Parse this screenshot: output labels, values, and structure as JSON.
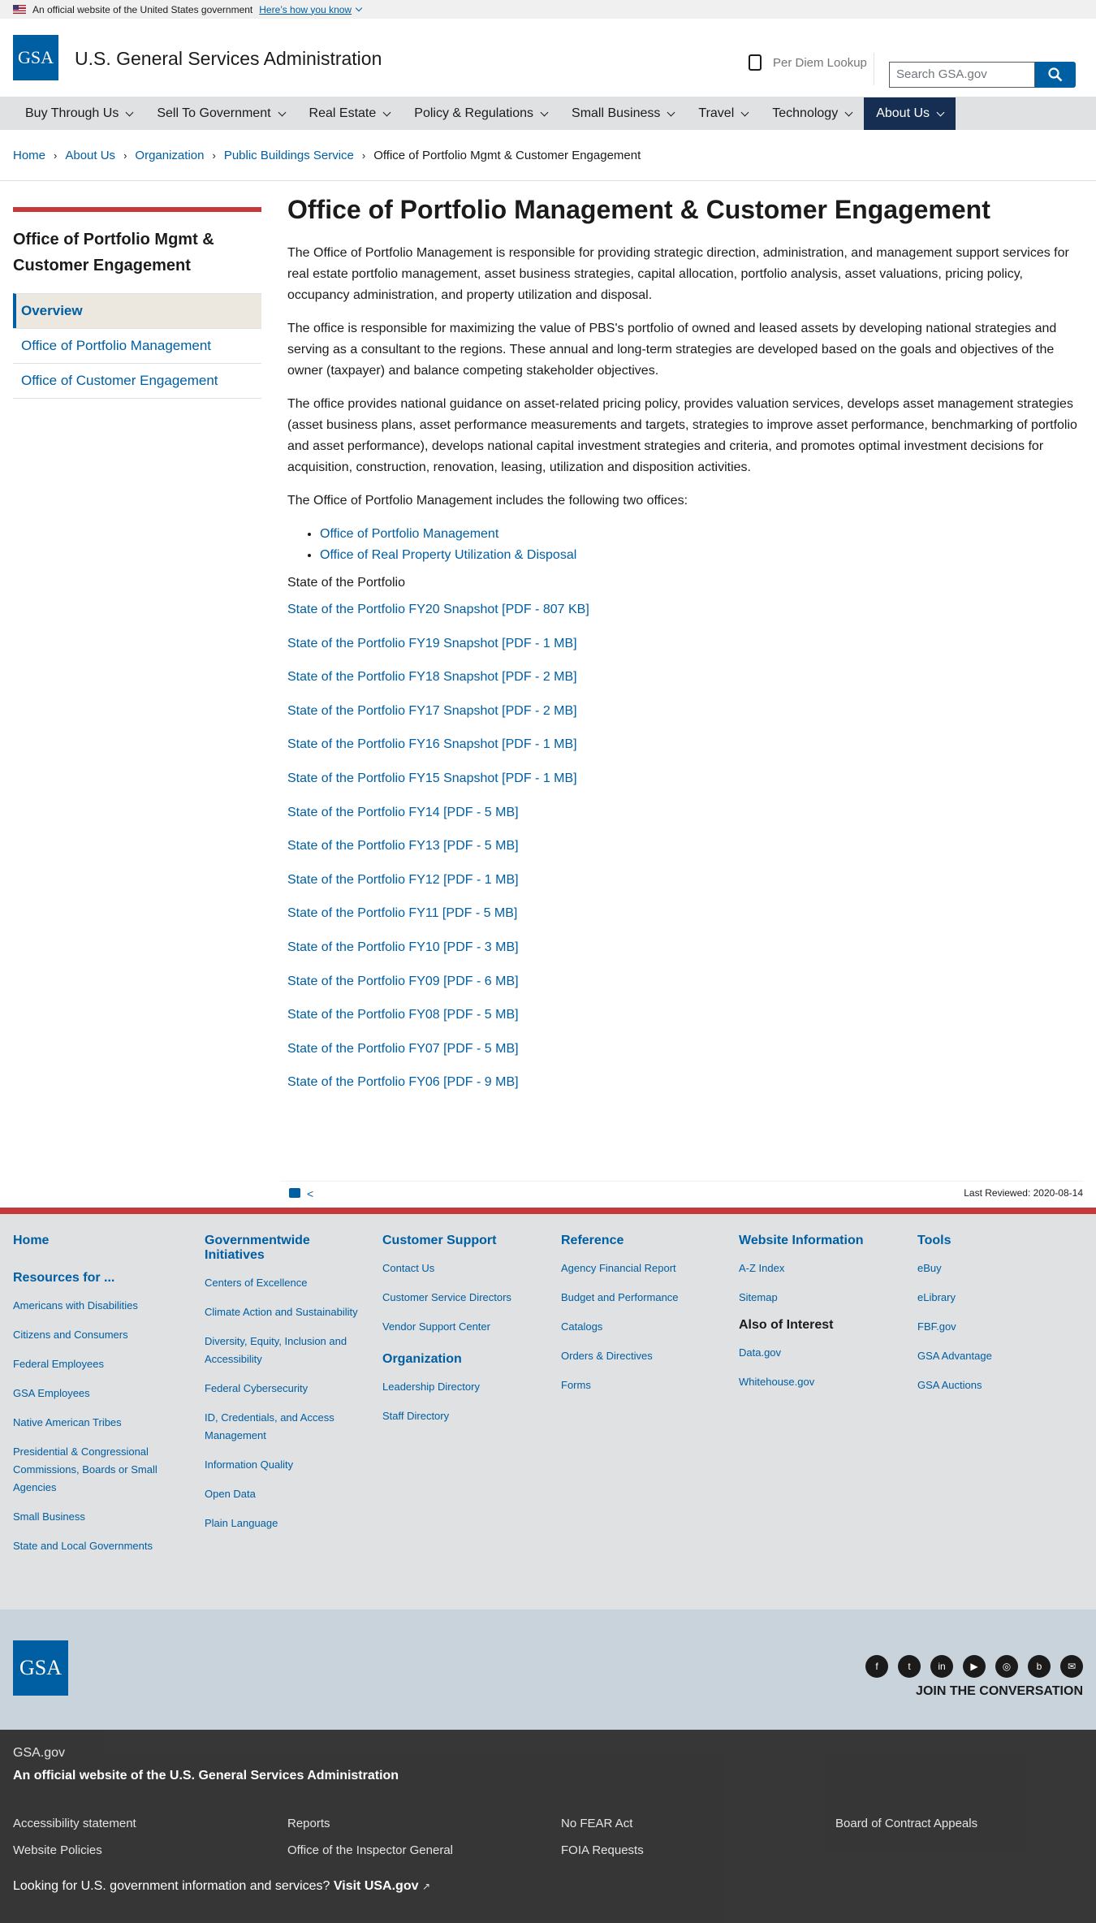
{
  "banner": {
    "text": "An official website of the United States government",
    "link": "Here’s how you know"
  },
  "header": {
    "logo_text": "GSA",
    "title": "U.S. General Services Administration",
    "per_diem": "Per Diem Lookup",
    "search_placeholder": "Search GSA.gov"
  },
  "nav": {
    "items": [
      {
        "label": "Buy Through Us"
      },
      {
        "label": "Sell To Government"
      },
      {
        "label": "Real Estate"
      },
      {
        "label": "Policy & Regulations"
      },
      {
        "label": "Small Business"
      },
      {
        "label": "Travel"
      },
      {
        "label": "Technology"
      },
      {
        "label": "About Us"
      }
    ]
  },
  "breadcrumb": [
    "Home",
    "About Us",
    "Organization",
    "Public Buildings Service",
    "Office of Portfolio Mgmt & Customer Engagement"
  ],
  "sidenav": {
    "title": "Office of Portfolio Mgmt & Customer Engagement",
    "items": [
      "Overview",
      "Office of Portfolio Management",
      "Office of Customer Engagement"
    ]
  },
  "main": {
    "title": "Office of Portfolio Management & Customer Engagement",
    "paragraphs": [
      "The Office of Portfolio Management is responsible for providing strategic direction, administration, and management support services for real estate portfolio management, asset business strategies, capital allocation, portfolio analysis, asset valuations, pricing policy, occupancy administration, and property utilization and disposal.",
      "The office is responsible for maximizing the value of PBS's portfolio of owned and leased assets by developing national strategies and serving as a consultant to the regions.  These annual and long-term strategies are developed based on the goals and objectives of the owner (taxpayer) and balance competing stakeholder objectives.",
      "The office provides national guidance on asset-related pricing policy, provides valuation services, develops asset management strategies (asset business plans, asset performance measurements and targets, strategies to improve asset performance, benchmarking of portfolio and asset performance), develops national capital investment strategies and criteria, and promotes optimal investment decisions for acquisition, construction, renovation, leasing, utilization and disposition activities.",
      "The Office of Portfolio Management includes the following two offices:"
    ],
    "offices": [
      "Office of Portfolio Management",
      "Office of Real Property Utilization & Disposal"
    ],
    "subheading": "State of the Portfolio",
    "reports": [
      "State of the Portfolio FY20 Snapshot [PDF - 807 KB]",
      "State of the Portfolio FY19 Snapshot [PDF - 1 MB]",
      "State of the Portfolio FY18 Snapshot [PDF - 2 MB]",
      "State of the Portfolio FY17 Snapshot [PDF - 2 MB]",
      "State of the Portfolio FY16 Snapshot [PDF - 1 MB]",
      "State of the Portfolio FY15 Snapshot [PDF - 1 MB]",
      "State of the Portfolio FY14 [PDF - 5 MB]",
      "State of the Portfolio FY13 [PDF - 5 MB]",
      "State of the Portfolio FY12 [PDF - 1 MB]",
      "State of the Portfolio FY11 [PDF - 5 MB]",
      "State of the Portfolio FY10 [PDF - 3 MB]",
      "State of the Portfolio FY09 [PDF - 6 MB]",
      "State of the Portfolio FY08 [PDF - 5 MB]",
      "State of the Portfolio FY07 [PDF - 5 MB]",
      "State of the Portfolio FY06 [PDF - 9 MB]"
    ],
    "last_reviewed": "Last Reviewed: 2020-08-14"
  },
  "footer": {
    "home": "Home",
    "resources_heading": "Resources for ...",
    "resources": [
      "Americans with Disabilities",
      "Citizens and Consumers",
      "Federal Employees",
      "GSA Employees",
      "Native American Tribes",
      "Presidential & Congressional Commissions, Boards or Small Agencies",
      "Small Business",
      "State and Local Governments"
    ],
    "gw_heading": "Governmentwide Initiatives",
    "gw": [
      "Centers of Excellence",
      "Climate Action and Sustainability",
      "Diversity, Equity, Inclusion and Accessibility",
      "Federal Cybersecurity",
      "ID, Credentials, and Access Management",
      "Information Quality",
      "Open Data",
      "Plain Language"
    ],
    "cs_heading": "Customer Support",
    "cs": [
      "Contact Us",
      "Customer Service Directors",
      "Vendor Support Center"
    ],
    "org_heading": "Organization",
    "org": [
      "Leadership Directory",
      "Staff Directory"
    ],
    "ref_heading": "Reference",
    "ref": [
      "Agency Financial Report",
      "Budget and Performance",
      "Catalogs",
      "Orders & Directives",
      "Forms"
    ],
    "wi_heading": "Website Information",
    "wi": [
      "A-Z Index",
      "Sitemap"
    ],
    "aoi_heading": "Also of Interest",
    "aoi": [
      "Data.gov",
      "Whitehouse.gov"
    ],
    "tools_heading": "Tools",
    "tools": [
      "eBuy",
      "eLibrary",
      "FBF.gov",
      "GSA Advantage",
      "GSA Auctions"
    ],
    "join": "JOIN THE CONVERSATION"
  },
  "identifier": {
    "domain": "GSA.gov",
    "official": "An official website of the U.S. General Services Administration",
    "links": [
      "Accessibility statement",
      "Reports",
      "No FEAR Act",
      "Board of Contract Appeals",
      "Website Policies",
      "Office of the Inspector General",
      "FOIA Requests"
    ],
    "usa_text": "Looking for U.S. government information and services?",
    "usa_link": "Visit USA.gov"
  }
}
